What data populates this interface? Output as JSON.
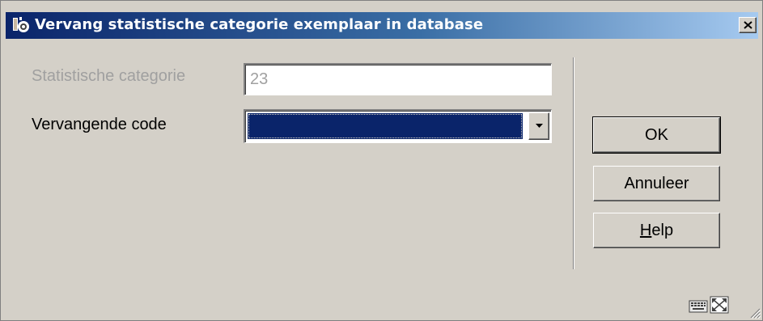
{
  "window": {
    "title": "Vervang statistische categorie exemplaar in database"
  },
  "form": {
    "field1": {
      "label": "Statistische categorie",
      "value": "23"
    },
    "field2": {
      "label": "Vervangende code",
      "value": ""
    }
  },
  "buttons": {
    "ok": "OK",
    "cancel": "Annuleer",
    "help": {
      "hotkey": "H",
      "rest": "elp"
    }
  },
  "icons": {
    "app": "app-icon",
    "close": "close-icon",
    "dropdown": "chevron-down-icon",
    "status_left": "keyboard-icon",
    "status_right": "fullscreen-icon",
    "grip": "resize-grip-icon"
  },
  "colors": {
    "titlebar_start": "#0a246a",
    "titlebar_end": "#a6caf0",
    "window_bg": "#d4d0c8",
    "selection": "#0a246a"
  }
}
